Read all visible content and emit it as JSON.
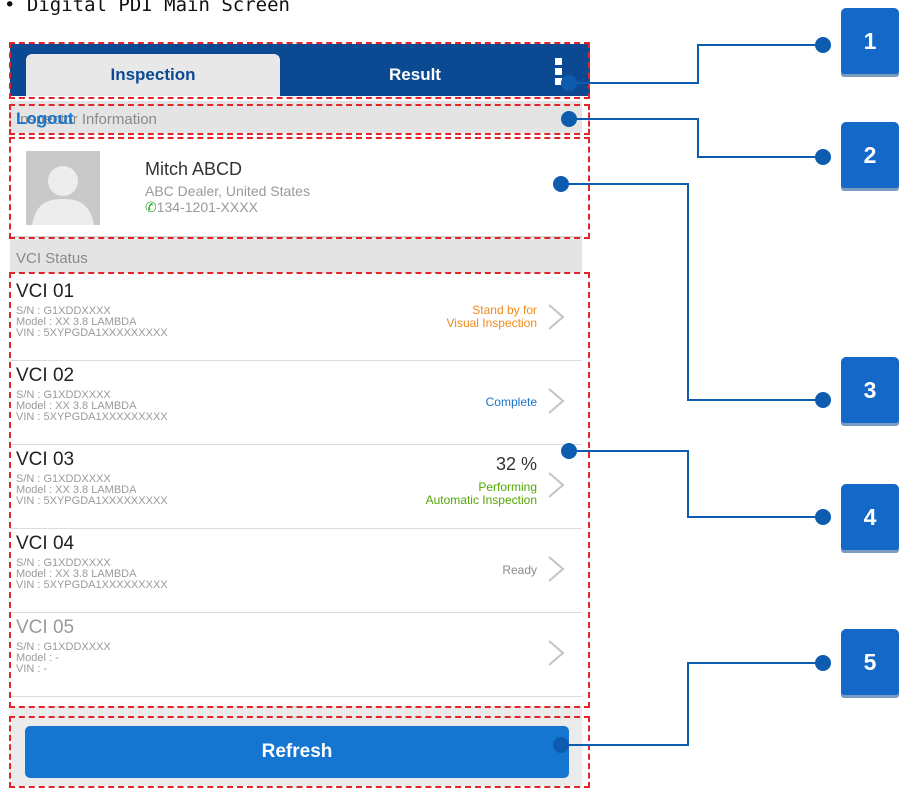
{
  "heading": "• Digital PDI Main Screen",
  "tabs": {
    "inspection": "Inspection",
    "result": "Result"
  },
  "inspector_section": {
    "title": "Inspector Information",
    "logout": "Logout"
  },
  "inspector": {
    "name": "Mitch ABCD",
    "dealer": "ABC Dealer, United States",
    "phone": "134-1201-XXXX"
  },
  "vci_section": {
    "title": "VCI Status"
  },
  "vci_list": [
    {
      "title": "VCI 01",
      "sn": "S/N : G1XDDXXXX",
      "model": "Model : XX 3.8 LAMBDA",
      "vin": "VIN : 5XYPGDA1XXXXXXXXX",
      "status_line1": "Stand by for",
      "status_line2": "Visual Inspection",
      "status_color": "#f08a1c"
    },
    {
      "title": "VCI 02",
      "sn": "S/N : G1XDDXXXX",
      "model": "Model : XX 3.8 LAMBDA",
      "vin": "VIN : 5XYPGDA1XXXXXXXXX",
      "status_line1": "Complete",
      "status_color": "#1774cc"
    },
    {
      "title": "VCI 03",
      "sn": "S/N : G1XDDXXXX",
      "model": "Model : XX 3.8 LAMBDA",
      "vin": "VIN : 5XYPGDA1XXXXXXXXX",
      "percent": "32 %",
      "status_line1": "Performing",
      "status_line2": "Automatic Inspection",
      "status_color": "#52a800"
    },
    {
      "title": "VCI 04",
      "sn": "S/N : G1XDDXXXX",
      "model": "Model : XX 3.8 LAMBDA",
      "vin": "VIN : 5XYPGDA1XXXXXXXXX",
      "status_line1": "Ready",
      "status_color": "#8a8a8a"
    },
    {
      "title": "VCI 05",
      "sn": "S/N : G1XDDXXXX",
      "model": "Model : -",
      "vin": "VIN : -"
    }
  ],
  "refresh_label": "Refresh",
  "callouts": [
    "1",
    "2",
    "3",
    "4",
    "5"
  ],
  "colors": {
    "header": "#0b4a92",
    "accent": "#1576d1",
    "annotation": "#e0262b",
    "callout": "#1468c8"
  }
}
